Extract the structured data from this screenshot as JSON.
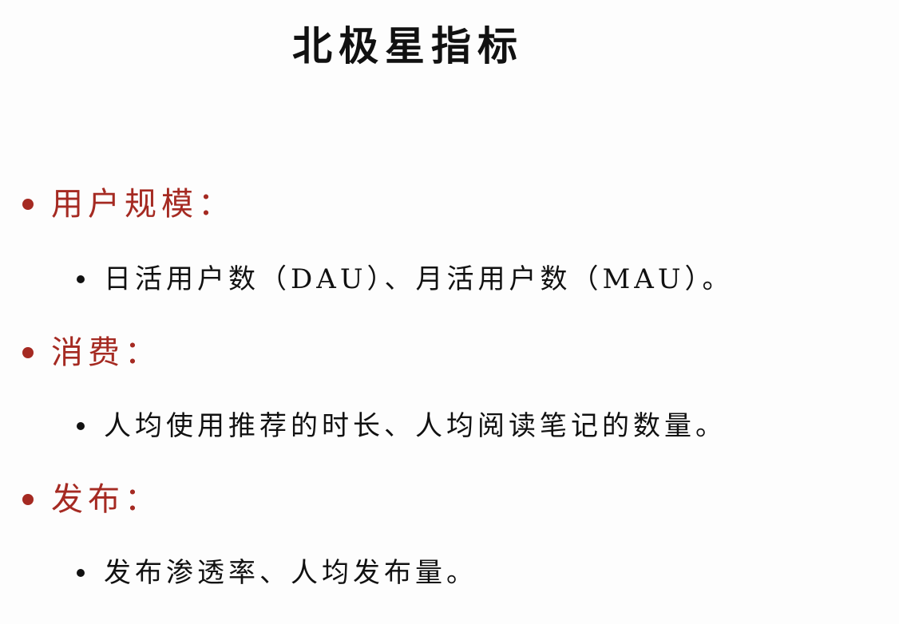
{
  "title": "北极星指标",
  "colors": {
    "accent": "#a52a22",
    "text": "#111111",
    "background": "#fdfdfd"
  },
  "sections": [
    {
      "label": "用户规模：",
      "items": [
        "日活用户数（DAU）、月活用户数（MAU）。"
      ]
    },
    {
      "label": "消费：",
      "items": [
        "人均使用推荐的时长、人均阅读笔记的数量。"
      ]
    },
    {
      "label": "发布：",
      "items": [
        "发布渗透率、人均发布量。"
      ]
    }
  ]
}
